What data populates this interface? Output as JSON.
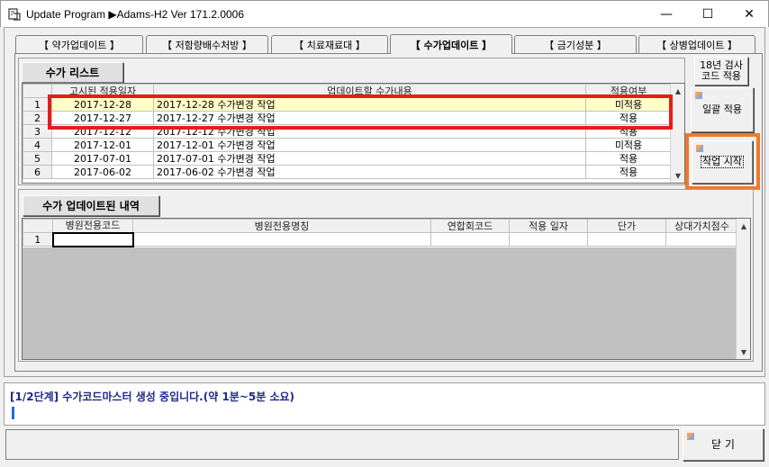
{
  "window": {
    "title": "Update Program  ▶Adams-H2 Ver 171.2.0006",
    "minimize": "—",
    "maximize": "☐",
    "close": "✕"
  },
  "tabs": [
    {
      "label": "【 약가업데이트 】"
    },
    {
      "label": "【 저함량배수처방 】"
    },
    {
      "label": "【 치료재료대 】"
    },
    {
      "label": "【 수가업데이트 】"
    },
    {
      "label": "【 금기성분 】"
    },
    {
      "label": "【 상병업데이트 】"
    }
  ],
  "fee_list": {
    "header": "수가 리스트",
    "columns": [
      "",
      "고시된 적용일자",
      "업데이트할 수가내용",
      "적용여부"
    ],
    "rows": [
      {
        "no": "1",
        "date": "2017-12-28",
        "content": "2017-12-28 수가변경 작업",
        "status": "미적용"
      },
      {
        "no": "2",
        "date": "2017-12-27",
        "content": "2017-12-27 수가변경 작업",
        "status": "적용"
      },
      {
        "no": "3",
        "date": "2017-12-12",
        "content": "2017-12-12 수가변경 작업",
        "status": "적용"
      },
      {
        "no": "4",
        "date": "2017-12-01",
        "content": "2017-12-01 수가변경 작업",
        "status": "미적용"
      },
      {
        "no": "5",
        "date": "2017-07-01",
        "content": "2017-07-01 수가변경 작업",
        "status": "적용"
      },
      {
        "no": "6",
        "date": "2017-06-02",
        "content": "2017-06-02 수가변경 작업",
        "status": "적용"
      }
    ]
  },
  "side_buttons": {
    "search_code": "18년 검사\n코드 적용",
    "bulk_apply": "일괄 적용",
    "start_work": "작업 시작"
  },
  "updated_list": {
    "header": "수가 업데이트된 내역",
    "columns": [
      "",
      "병원전용코드",
      "병원전용명칭",
      "연합회코드",
      "적용 일자",
      "단가",
      "상대가치점수"
    ],
    "rows": [
      {
        "no": "1",
        "cells": [
          "",
          "",
          "",
          "",
          "",
          ""
        ]
      }
    ]
  },
  "status": {
    "message": "[1/2단계] 수가코드마스터 생성 중입니다.(약 1분~5분 소요)"
  },
  "footer": {
    "close_label": "닫 기"
  }
}
